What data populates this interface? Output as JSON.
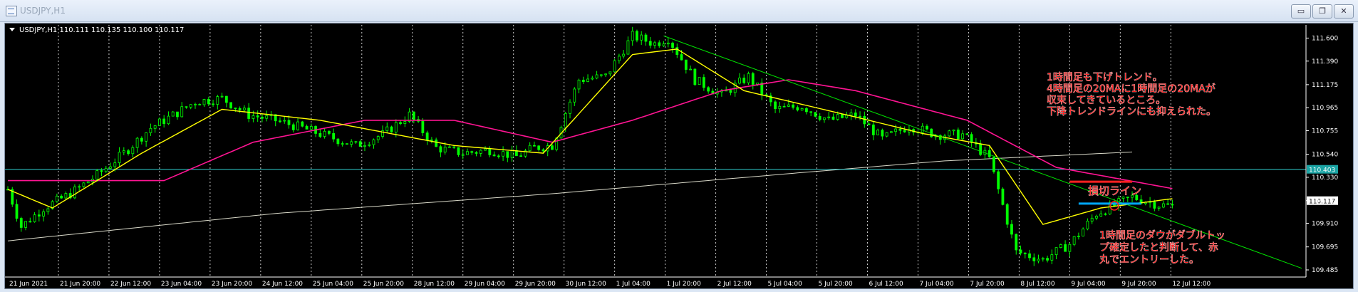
{
  "window": {
    "title": "USDJPY,H1",
    "minimize_label": "▭",
    "restore_label": "❐",
    "close_label": "✕"
  },
  "colors": {
    "background": "#000000",
    "candle": "#00ff00",
    "ma_fast": "#ffff00",
    "ma_slow": "#ff1493",
    "ma_long": "#d8d8c8",
    "grid": "#c8c8c8",
    "annotation": "#ff2020",
    "price_line": "#2fd0d0",
    "trendline": "#00e000",
    "support": "#00a8ff"
  },
  "chart_data": {
    "type": "candlestick",
    "symbol_header": "USDJPY,H1  110.111 110.135 110.100 110.117",
    "ylim": [
      109.42,
      111.72
    ],
    "y_ticks": [
      "111.600",
      "111.390",
      "111.175",
      "110.965",
      "110.755",
      "110.540",
      "110.330",
      "110.117",
      "109.910",
      "109.695",
      "109.485"
    ],
    "y_tick_values": [
      111.6,
      111.39,
      111.175,
      110.965,
      110.755,
      110.54,
      110.33,
      110.117,
      109.91,
      109.695,
      109.485
    ],
    "x_ticks": [
      "21 Jun 2021",
      "21 Jun 20:00",
      "22 Jun 12:00",
      "23 Jun 04:00",
      "23 Jun 20:00",
      "24 Jun 12:00",
      "25 Jun 04:00",
      "25 Jun 20:00",
      "28 Jun 12:00",
      "29 Jun 04:00",
      "29 Jun 20:00",
      "30 Jun 12:00",
      "1 Jul 04:00",
      "1 Jul 20:00",
      "2 Jul 12:00",
      "5 Jul 04:00",
      "5 Jul 20:00",
      "6 Jul 12:00",
      "7 Jul 04:00",
      "7 Jul 20:00",
      "8 Jul 12:00",
      "9 Jul 04:00",
      "9 Jul 20:00",
      "12 Jul 12:00"
    ],
    "bar_index_range": [
      0,
      240
    ],
    "price_keypoints": [
      [
        0,
        110.22
      ],
      [
        3,
        109.88
      ],
      [
        8,
        110.05
      ],
      [
        14,
        110.18
      ],
      [
        20,
        110.35
      ],
      [
        26,
        110.55
      ],
      [
        32,
        110.78
      ],
      [
        38,
        110.92
      ],
      [
        42,
        111.02
      ],
      [
        48,
        111.05
      ],
      [
        54,
        110.9
      ],
      [
        60,
        110.85
      ],
      [
        66,
        110.78
      ],
      [
        72,
        110.7
      ],
      [
        78,
        110.62
      ],
      [
        84,
        110.72
      ],
      [
        90,
        110.9
      ],
      [
        96,
        110.6
      ],
      [
        102,
        110.55
      ],
      [
        108,
        110.58
      ],
      [
        114,
        110.52
      ],
      [
        118,
        110.6
      ],
      [
        122,
        110.62
      ],
      [
        128,
        111.22
      ],
      [
        134,
        111.25
      ],
      [
        140,
        111.62
      ],
      [
        145,
        111.55
      ],
      [
        148,
        111.6
      ],
      [
        154,
        111.22
      ],
      [
        160,
        111.08
      ],
      [
        166,
        111.25
      ],
      [
        172,
        110.95
      ],
      [
        178,
        110.98
      ],
      [
        184,
        110.85
      ],
      [
        190,
        110.9
      ],
      [
        196,
        110.68
      ],
      [
        202,
        110.8
      ],
      [
        208,
        110.72
      ],
      [
        214,
        110.72
      ],
      [
        220,
        110.5
      ],
      [
        226,
        109.65
      ],
      [
        232,
        109.58
      ],
      [
        238,
        109.72
      ],
      [
        244,
        110.0
      ],
      [
        252,
        110.15
      ],
      [
        258,
        110.08
      ],
      [
        262,
        110.06
      ]
    ],
    "bars_total": 262,
    "ma_fast_keypoints": [
      [
        0,
        110.22
      ],
      [
        10,
        110.05
      ],
      [
        30,
        110.55
      ],
      [
        48,
        110.95
      ],
      [
        70,
        110.85
      ],
      [
        100,
        110.62
      ],
      [
        120,
        110.55
      ],
      [
        140,
        111.45
      ],
      [
        150,
        111.5
      ],
      [
        165,
        111.12
      ],
      [
        190,
        110.88
      ],
      [
        205,
        110.73
      ],
      [
        220,
        110.62
      ],
      [
        232,
        109.9
      ],
      [
        245,
        110.05
      ],
      [
        262,
        110.14
      ]
    ],
    "ma_slow_keypoints": [
      [
        0,
        110.3
      ],
      [
        35,
        110.3
      ],
      [
        55,
        110.65
      ],
      [
        80,
        110.85
      ],
      [
        100,
        110.85
      ],
      [
        122,
        110.65
      ],
      [
        140,
        110.85
      ],
      [
        160,
        111.12
      ],
      [
        175,
        111.22
      ],
      [
        190,
        111.12
      ],
      [
        215,
        110.85
      ],
      [
        235,
        110.42
      ],
      [
        262,
        110.22
      ]
    ],
    "ma_long_keypoints": [
      [
        0,
        109.75
      ],
      [
        60,
        110.0
      ],
      [
        122,
        110.18
      ],
      [
        180,
        110.38
      ],
      [
        210,
        110.48
      ],
      [
        262,
        110.58
      ]
    ],
    "ma_long_end_index": 252,
    "trendline_points": [
      [
        147,
        111.62
      ],
      [
        290,
        109.5
      ]
    ],
    "current_price": 110.117,
    "current_price_label": "110.117",
    "horizontal_line_price": 110.403,
    "horizontal_line_label": "110.403",
    "stop_line": {
      "from_index": 238,
      "to_index": 252,
      "price": 110.29
    },
    "support_line": {
      "from_index": 240,
      "to_index": 254,
      "price": 110.09
    },
    "entry_marker": {
      "index": 248,
      "price": 110.07
    },
    "annotations": [
      {
        "lines": [
          "1時間足も下げトレンド。",
          "4時間足の20MAに1時間足の20MAが",
          "収束してきているところ。",
          "下降トレンドラインにも抑えられた。"
        ]
      },
      {
        "lines": [
          "損切ライン"
        ]
      },
      {
        "lines": [
          "1時間足のダウがダブルトッ",
          "プ確定したと判断して、赤",
          "丸でエントリーした。"
        ]
      }
    ]
  }
}
